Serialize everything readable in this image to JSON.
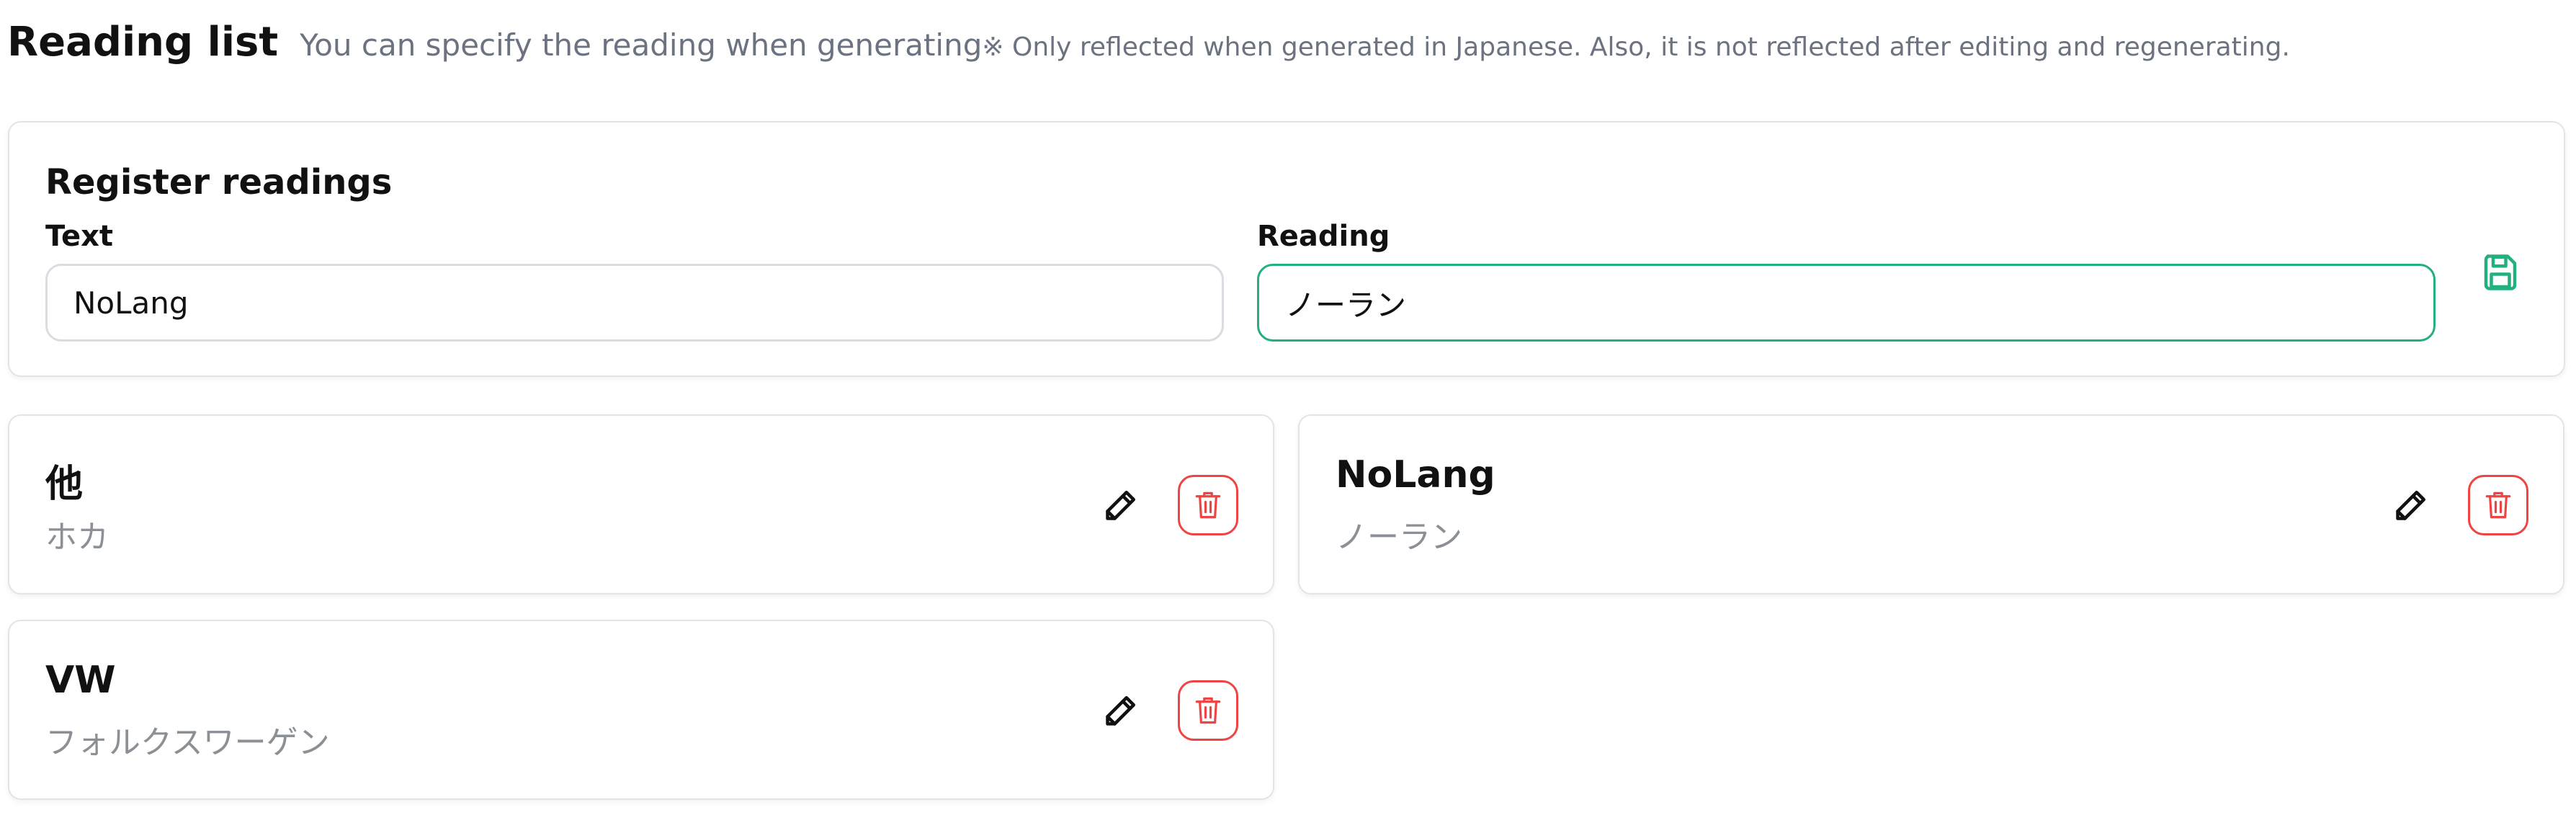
{
  "header": {
    "title": "Reading list",
    "subtitle": "You can specify the reading when generating",
    "note": "※ Only reflected when generated in Japanese. Also, it is not reflected after editing and regenerating."
  },
  "register": {
    "title": "Register readings",
    "text_label": "Text",
    "text_value": "NoLang",
    "reading_label": "Reading",
    "reading_value": "ノーラン",
    "save_icon": "save-icon"
  },
  "items": [
    {
      "text": "他",
      "reading": "ホカ"
    },
    {
      "text": "NoLang",
      "reading": "ノーラン"
    },
    {
      "text": "VW",
      "reading": "フォルクスワーゲン"
    }
  ],
  "icons": {
    "edit": "pencil-icon",
    "delete": "trash-icon"
  },
  "colors": {
    "accent_green": "#22b07d",
    "danger_red": "#ef4444",
    "muted_text": "#6b7280"
  }
}
